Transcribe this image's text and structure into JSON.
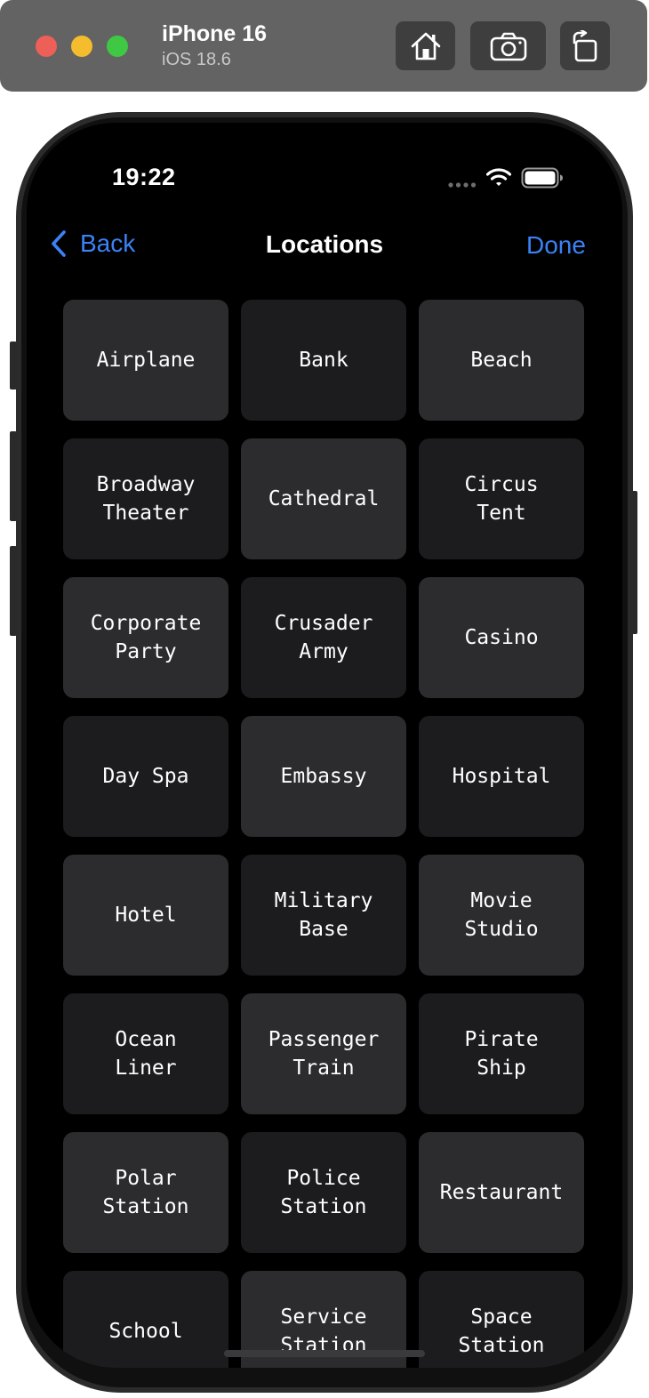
{
  "simulator": {
    "device_name": "iPhone 16",
    "os_version": "iOS 18.6",
    "toolbar_icons": [
      "home-icon",
      "screenshot-icon",
      "rotate-icon"
    ]
  },
  "status_bar": {
    "time": "19:22",
    "icons": [
      "cellular-dots-icon",
      "wifi-icon",
      "battery-icon"
    ]
  },
  "nav": {
    "back_label": "Back",
    "title": "Locations",
    "done_label": "Done",
    "accent_color": "#3b82f6"
  },
  "locations": [
    {
      "label": "Airplane",
      "tone": "light"
    },
    {
      "label": "Bank",
      "tone": "dark"
    },
    {
      "label": "Beach",
      "tone": "light"
    },
    {
      "label": "Broadway\nTheater",
      "tone": "dark"
    },
    {
      "label": "Cathedral",
      "tone": "light"
    },
    {
      "label": "Circus\nTent",
      "tone": "dark"
    },
    {
      "label": "Corporate\nParty",
      "tone": "light"
    },
    {
      "label": "Crusader\nArmy",
      "tone": "dark"
    },
    {
      "label": "Casino",
      "tone": "light"
    },
    {
      "label": "Day Spa",
      "tone": "dark"
    },
    {
      "label": "Embassy",
      "tone": "light"
    },
    {
      "label": "Hospital",
      "tone": "dark"
    },
    {
      "label": "Hotel",
      "tone": "light"
    },
    {
      "label": "Military\nBase",
      "tone": "dark"
    },
    {
      "label": "Movie\nStudio",
      "tone": "light"
    },
    {
      "label": "Ocean\nLiner",
      "tone": "dark"
    },
    {
      "label": "Passenger\nTrain",
      "tone": "light"
    },
    {
      "label": "Pirate\nShip",
      "tone": "dark"
    },
    {
      "label": "Polar\nStation",
      "tone": "light"
    },
    {
      "label": "Police\nStation",
      "tone": "dark"
    },
    {
      "label": "Restaurant",
      "tone": "light"
    },
    {
      "label": "School",
      "tone": "dark"
    },
    {
      "label": "Service\nStation",
      "tone": "light"
    },
    {
      "label": "Space\nStation",
      "tone": "dark"
    }
  ],
  "colors": {
    "tile_light": "#2c2c2e",
    "tile_dark": "#1c1c1e",
    "screen_background": "#000000"
  }
}
